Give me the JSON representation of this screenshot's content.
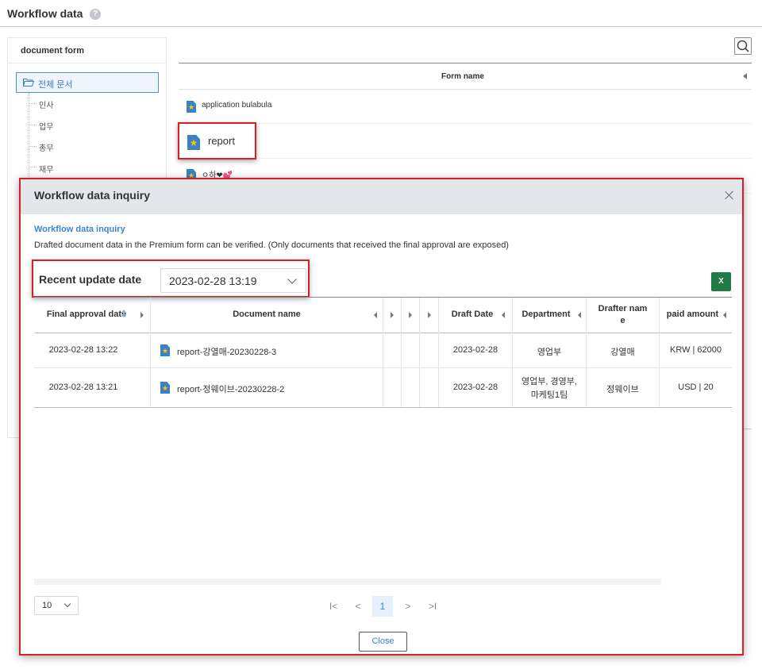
{
  "page": {
    "title": "Workflow data",
    "help_icon": "?"
  },
  "left_panel": {
    "title": "document form",
    "root_label": "전체 문서",
    "items": [
      "인사",
      "업무",
      "총무",
      "재무"
    ]
  },
  "right_panel": {
    "column_header": "Form name",
    "rows": [
      "application bulabula",
      "report",
      "ㅇ하❤💕"
    ]
  },
  "modal": {
    "title": "Workflow data inquiry",
    "subtitle": "Workflow data inquiry",
    "description": "Drafted document data in the Premium form can be verified. (Only documents that received the final approval are exposed)",
    "date_label": "Recent update date",
    "date_value": "2023-02-28 13:19",
    "excel_label": "X",
    "table": {
      "headers": {
        "final_approval_date": "Final approval date",
        "document_name": "Document name",
        "draft_date": "Draft Date",
        "department": "Department",
        "drafter_name": "Drafter nam e",
        "drafter_name_line1": "Drafter nam",
        "drafter_name_line2": "e",
        "paid_amount": "paid amount"
      },
      "rows": [
        {
          "final_approval_date": "2023-02-28 13:22",
          "document_name": "report-강열매-20230228-3",
          "draft_date": "2023-02-28",
          "department_line1": "영업부",
          "department_line2": "",
          "drafter_name": "강열매",
          "paid_amount": "KRW | 62000"
        },
        {
          "final_approval_date": "2023-02-28 13:21",
          "document_name": "report-정웨이브-20230228-2",
          "draft_date": "2023-02-28",
          "department_line1": "영업부, 경영부,",
          "department_line2": "마케팅1팀",
          "drafter_name": "정웨이브",
          "paid_amount": "USD | 20"
        }
      ]
    },
    "pager": {
      "page_size": "10",
      "first": "I<",
      "prev": "<",
      "current": "1",
      "next": ">",
      "last": ">I"
    },
    "close_label": "Close"
  }
}
